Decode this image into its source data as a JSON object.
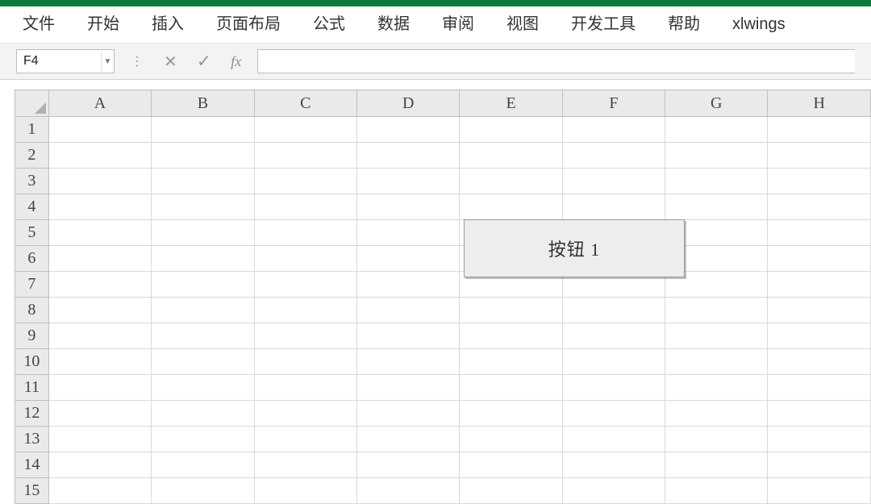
{
  "ribbon": {
    "tabs": [
      "文件",
      "开始",
      "插入",
      "页面布局",
      "公式",
      "数据",
      "审阅",
      "视图",
      "开发工具",
      "帮助",
      "xlwings"
    ]
  },
  "formula_bar": {
    "namebox_value": "F4",
    "fx_label": "fx",
    "formula_value": ""
  },
  "grid": {
    "columns": [
      "A",
      "B",
      "C",
      "D",
      "E",
      "F",
      "G",
      "H"
    ],
    "rows": [
      "1",
      "2",
      "3",
      "4",
      "5",
      "6",
      "7",
      "8",
      "9",
      "10",
      "11",
      "12",
      "13",
      "14",
      "15"
    ]
  },
  "sheet": {
    "button_label": "按钮 1"
  }
}
